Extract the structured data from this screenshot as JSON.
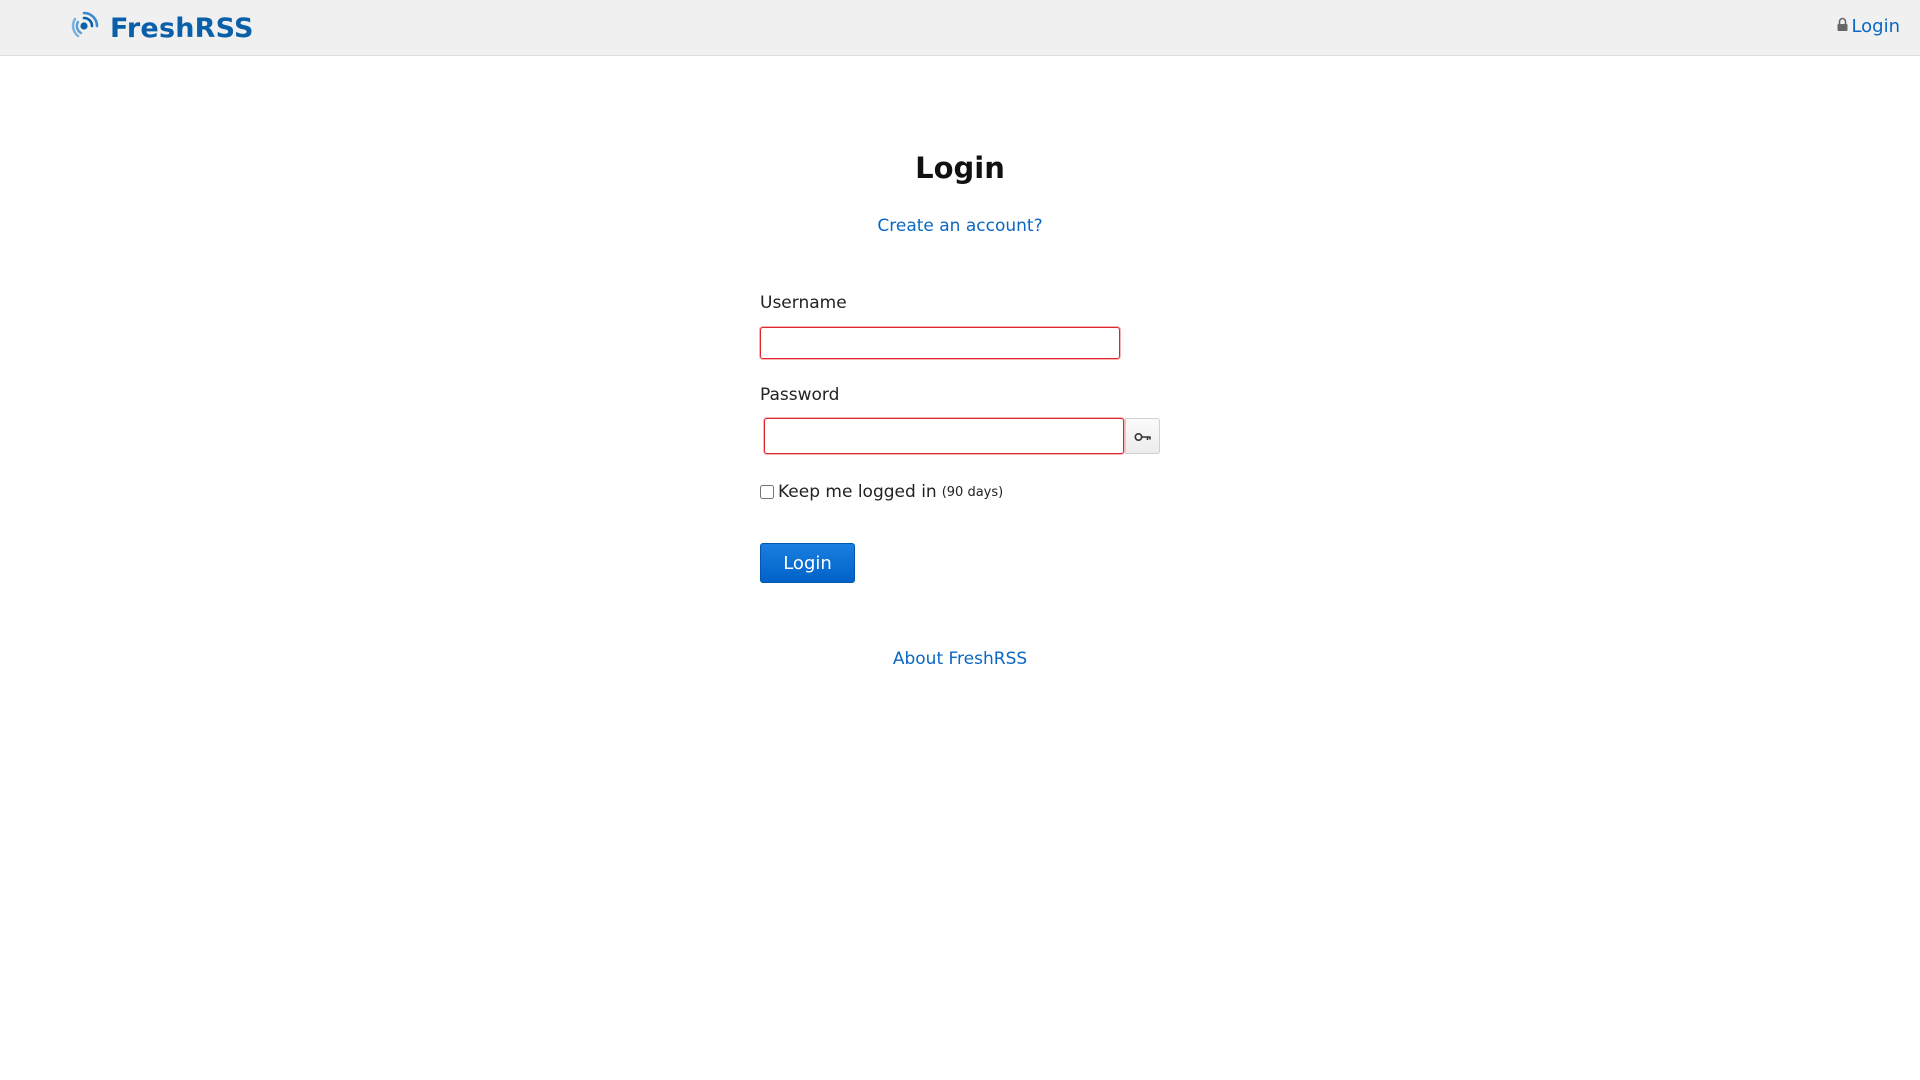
{
  "header": {
    "logo_text": "FreshRSS",
    "login_label": "Login",
    "logo_icon": "freshrss-logo-icon",
    "lock_icon": "lock-icon"
  },
  "main": {
    "title": "Login",
    "create_account_label": "Create an account?",
    "username_label": "Username",
    "username_value": "",
    "password_label": "Password",
    "password_value": "",
    "toggle_password_icon": "key-icon",
    "keep_logged_label": "Keep me logged in",
    "keep_logged_note": "(90 days)",
    "keep_logged_checked": false,
    "submit_label": "Login",
    "about_label": "About FreshRSS"
  },
  "colors": {
    "brand": "#0a5fa9",
    "link": "#0a67c4",
    "button": "#0062c8",
    "input_error_border": "#e0262c",
    "header_bg": "#f0f0f0"
  }
}
